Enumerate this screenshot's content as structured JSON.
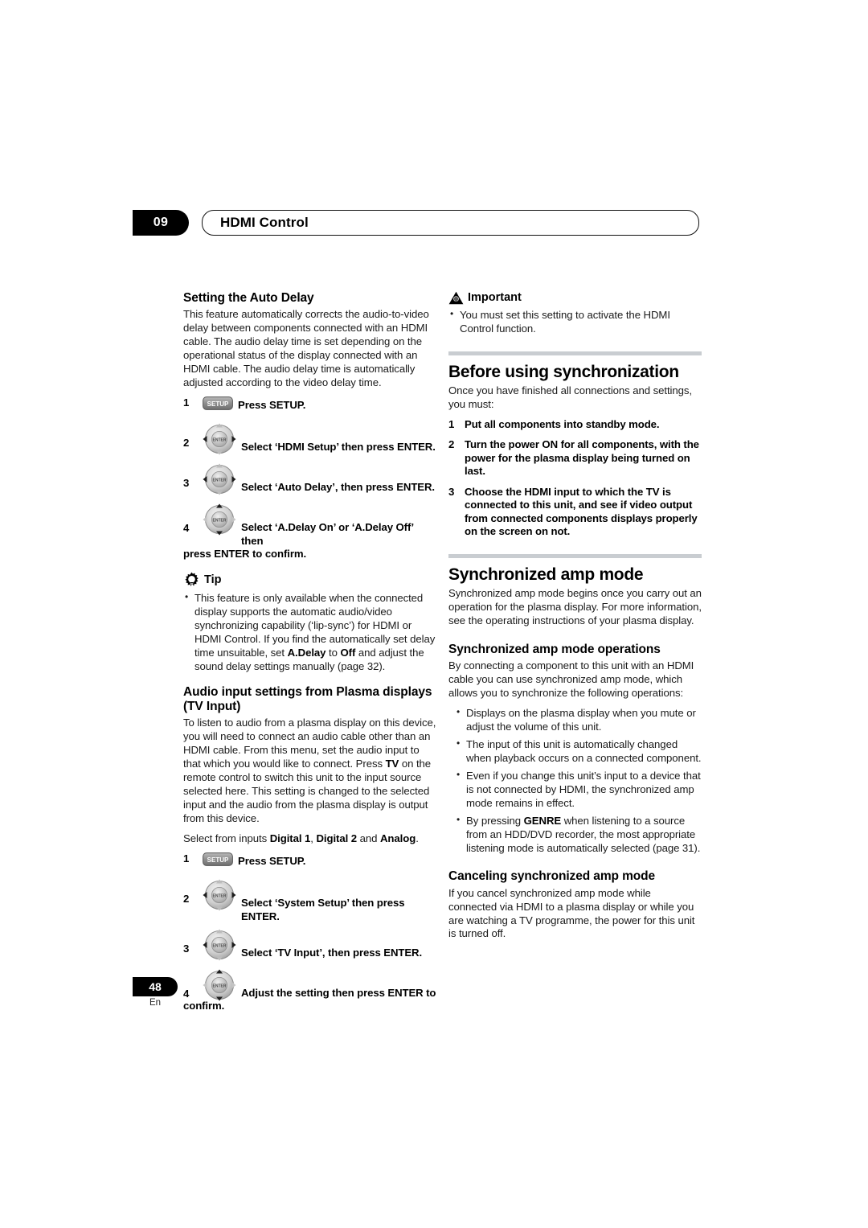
{
  "header": {
    "chapter_number": "09",
    "title": "HDMI Control"
  },
  "footer": {
    "page_number": "48",
    "language_code": "En"
  },
  "icons": {
    "setup_key_label": "SETUP",
    "enter_key_label": "ENTER",
    "important_icon": "warning-triangle-icon",
    "tip_icon": "lightbulb-gear-icon"
  },
  "left_column": {
    "auto_delay": {
      "heading": "Setting the Auto Delay",
      "body": "This feature automatically corrects the audio-to-video delay between components connected with an HDMI cable. The audio delay time is set depending on the operational status of the display connected with an HDMI cable. The audio delay time is automatically adjusted according to the video delay time.",
      "steps": [
        {
          "num": "1",
          "icon": "setup",
          "text": "Press SETUP."
        },
        {
          "num": "2",
          "icon": "dpad",
          "text": "Select ‘HDMI Setup’ then press ENTER."
        },
        {
          "num": "3",
          "icon": "dpad",
          "text": "Select ‘Auto Delay’, then press ENTER."
        },
        {
          "num": "4",
          "icon": "dpad-vertical",
          "text": "Select ‘A.Delay On’ or ‘A.Delay Off’ then",
          "continuation": "press ENTER to confirm."
        }
      ]
    },
    "tip": {
      "label": "Tip",
      "bullets_html": "This feature is only available when the connected display supports the automatic audio/video synchronizing capability (‘lip-sync’) for HDMI or HDMI Control. If you find the automatically set delay time unsuitable, set <b>A.Delay</b> to <b>Off</b> and adjust the sound delay settings manually (page 32)."
    },
    "tv_input": {
      "heading_line1": "Audio input settings from Plasma displays",
      "heading_line2": "(TV Input)",
      "body_html": "To listen to audio from a plasma display on this device, you will need to connect an audio cable other than an HDMI cable. From this menu, set the audio input to that which you would like to connect. Press <b>TV</b> on the remote control to switch this unit to the input source selected here. This setting is changed to the selected input and the audio from the plasma display is output from this device.",
      "select_line_html": "Select from inputs <b>Digital 1</b>, <b>Digital 2</b> and <b>Analog</b>.",
      "steps": [
        {
          "num": "1",
          "icon": "setup",
          "text": "Press SETUP."
        },
        {
          "num": "2",
          "icon": "dpad",
          "text": "Select ‘System Setup’ then press ENTER."
        },
        {
          "num": "3",
          "icon": "dpad",
          "text": "Select ‘TV Input’, then press ENTER."
        },
        {
          "num": "4",
          "icon": "dpad-vertical",
          "text": "Adjust the setting then press ENTER to",
          "continuation": "confirm."
        }
      ]
    }
  },
  "right_column": {
    "important": {
      "label": "Important",
      "bullet": "You must set this setting to activate the HDMI Control function."
    },
    "before_sync": {
      "heading": "Before using synchronization",
      "body": "Once you have finished all connections and settings, you must:",
      "steps": [
        {
          "num": "1",
          "text": "Put all components into standby mode."
        },
        {
          "num": "2",
          "text": "Turn the power ON for all components, with the power for the plasma display being turned on last."
        },
        {
          "num": "3",
          "text": "Choose the HDMI input to which the TV is connected to this unit, and see if video output from connected components displays properly on the screen on not."
        }
      ]
    },
    "sync_amp": {
      "heading": "Synchronized amp mode",
      "body": "Synchronized amp mode begins once you carry out an operation for the plasma display. For more information, see the operating instructions of your plasma display."
    },
    "sync_amp_ops": {
      "heading": "Synchronized amp mode operations",
      "body": "By connecting a component to this unit with an HDMI cable you can use synchronized amp mode, which allows you to synchronize the following operations:",
      "bullets_html": [
        "Displays on the plasma display when you mute or adjust the volume of this unit.",
        "The input of this unit is automatically changed when playback occurs on a connected component.",
        "Even if you change this unit’s input to a device that is not connected by HDMI, the synchronized amp mode remains in effect.",
        "By pressing <b>GENRE</b> when listening to a source from an HDD/DVD recorder, the most appropriate listening mode is automatically selected (page 31)."
      ]
    },
    "cancel_sync": {
      "heading": "Canceling synchronized amp mode",
      "body": "If you cancel synchronized amp mode while connected via HDMI to a plasma display or while you are watching a TV programme, the power for this unit is turned off."
    }
  },
  "colors": {
    "rule": "#c9cdd1",
    "badge_background": "#000000",
    "text": "#1a1a1a"
  }
}
